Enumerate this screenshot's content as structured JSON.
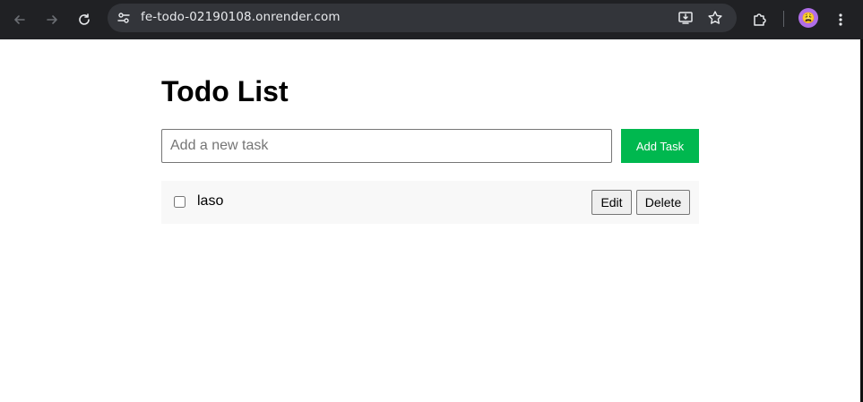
{
  "browser": {
    "url": "fe-todo-02190108.onrender.com",
    "icons": {
      "back": "arrow-left-icon",
      "forward": "arrow-right-icon",
      "reload": "reload-icon",
      "site_info": "tune-icon",
      "install": "install-app-icon",
      "bookmark": "star-icon",
      "extensions": "puzzle-icon",
      "profile": "avatar",
      "menu": "kebab-menu-icon"
    },
    "profile_emoji": "😩"
  },
  "app": {
    "title": "Todo List",
    "input": {
      "value": "",
      "placeholder": "Add a new task"
    },
    "add_button_label": "Add Task",
    "accent_color": "#00b84f",
    "todos": [
      {
        "text": "laso",
        "completed": false,
        "edit_label": "Edit",
        "delete_label": "Delete"
      }
    ]
  }
}
